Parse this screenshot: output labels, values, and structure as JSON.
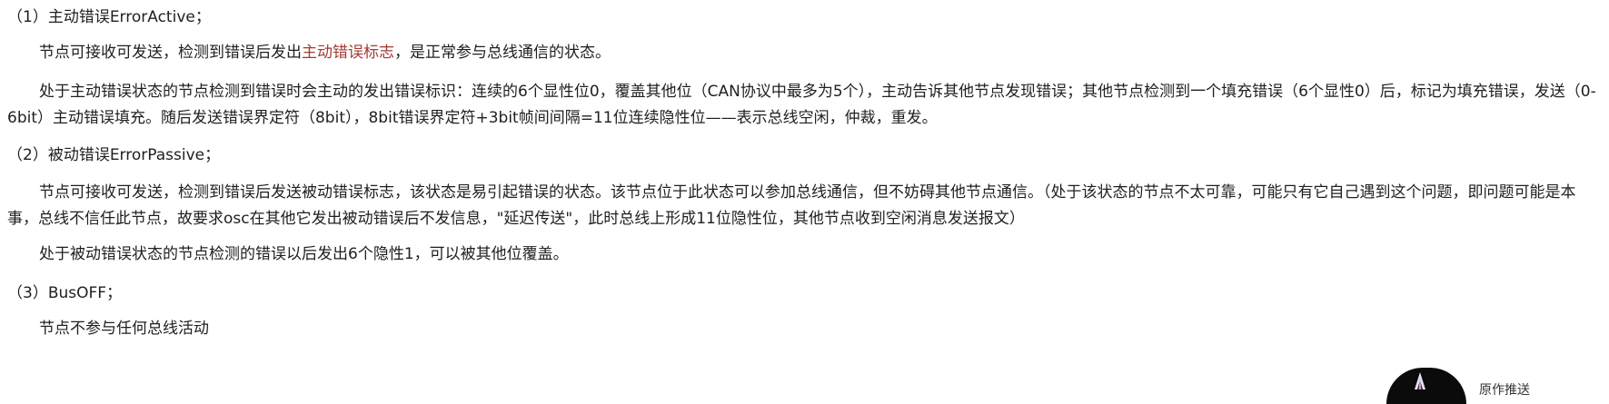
{
  "sections": [
    {
      "heading": "（1）主动错误ErrorActive；",
      "p1_before": "节点可接收可发送，检测到错误后发出",
      "p1_link": "主动错误标志",
      "p1_after": "，是正常参与总线通信的状态。",
      "p2": "处于主动错误状态的节点检测到错误时会主动的发出错误标识：连续的6个显性位0，覆盖其他位（CAN协议中最多为5个），主动告诉其他节点发现错误；其他节点检测到一个填充错误（6个显性0）后，标记为填充错误，发送（0-6bit）主动错误填充。随后发送错误界定符（8bit），8bit错误界定符+3bit帧间间隔=11位连续隐性位——表示总线空闲，仲裁，重发。"
    },
    {
      "heading": "（2）被动错误ErrorPassive；",
      "p1": "节点可接收可发送，检测到错误后发送被动错误标志，该状态是易引起错误的状态。该节点位于此状态可以参加总线通信，但不妨碍其他节点通信。（处于该状态的节点不太可靠，可能只有它自己遇到这个问题，即问题可能是本事，总线不信任此节点，故要求osc在其他它发出被动错误后不发信息，\"延迟传送\"，此时总线上形成11位隐性位，其他节点收到空闲消息发送报文）",
      "p2": "处于被动错误状态的节点检测的错误以后发出6个隐性1，可以被其他位覆盖。"
    },
    {
      "heading": "（3）BusOFF；",
      "p1": "节点不参与任何总线活动"
    }
  ],
  "floating_widget": {
    "icon": "tree-emblem-icon",
    "label": "原作推送"
  }
}
